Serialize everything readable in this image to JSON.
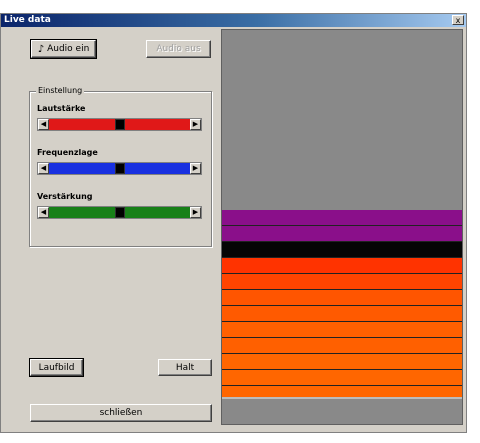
{
  "window": {
    "title": "Live data",
    "close_glyph": "x"
  },
  "buttons": {
    "audio_on": "Audio ein",
    "audio_on_icon": "music-note-icon",
    "audio_off": "Audio aus",
    "laufbild": "Laufbild",
    "halt": "Halt",
    "close": "schließen"
  },
  "settings": {
    "group_label": "Einstellung",
    "sliders": [
      {
        "label": "Lautstärke",
        "color": "#e01818",
        "position": 0.5
      },
      {
        "label": "Frequenzlage",
        "color": "#1830e0",
        "position": 0.5
      },
      {
        "label": "Verstärkung",
        "color": "#188018",
        "position": 0.5
      }
    ]
  },
  "display": {
    "background_color": "#898989",
    "bands": [
      {
        "color": "#8a0f8a"
      },
      {
        "color": "#8a0f8a"
      },
      {
        "color": "#050505"
      },
      {
        "color": "#ff3300"
      },
      {
        "color": "#ff4400"
      },
      {
        "color": "#ff5500"
      },
      {
        "color": "#ff5a00"
      },
      {
        "color": "#ff6000"
      },
      {
        "color": "#ff6000"
      },
      {
        "color": "#ff6600"
      },
      {
        "color": "#ff6600"
      },
      {
        "color": "#ff6600"
      }
    ]
  }
}
